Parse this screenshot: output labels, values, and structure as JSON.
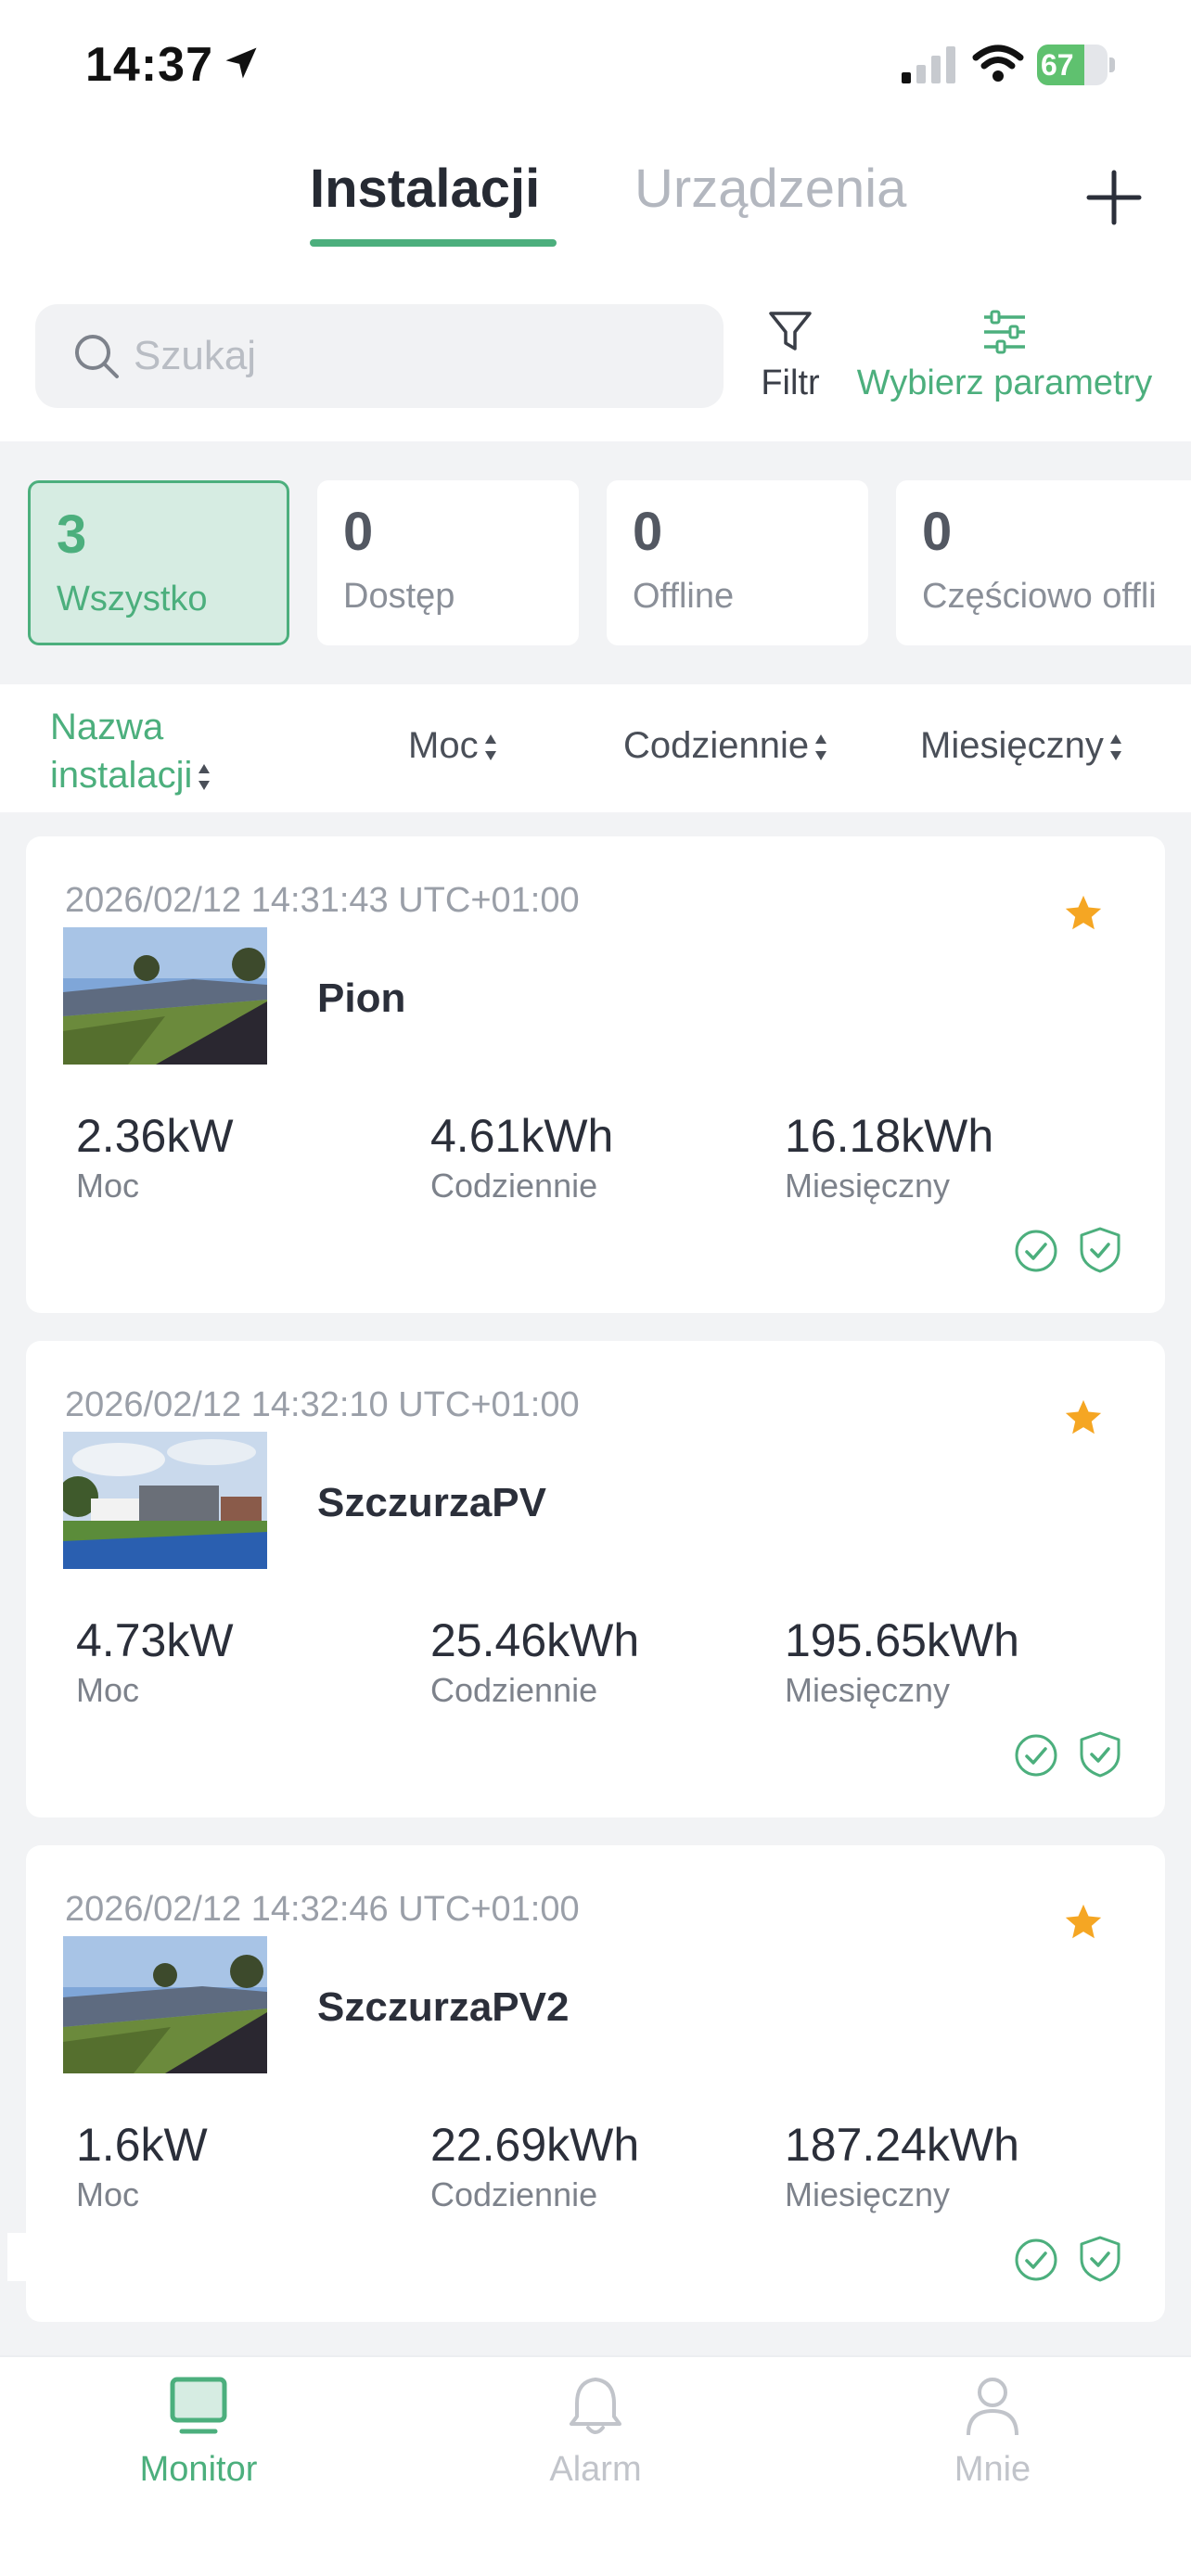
{
  "status_bar": {
    "time": "14:37",
    "battery_level": "67",
    "icons": [
      "location-arrow-icon",
      "cellular-signal-icon",
      "wifi-icon",
      "battery-charging-icon"
    ]
  },
  "header": {
    "tabs": [
      {
        "label": "Instalacji",
        "active": true
      },
      {
        "label": "Urządzenia",
        "active": false
      }
    ],
    "add_icon": "plus-icon"
  },
  "search": {
    "placeholder": "Szukaj",
    "value": "",
    "filter_label": "Filtr",
    "params_label": "Wybierz parametry"
  },
  "summary": [
    {
      "count": "3",
      "label": "Wszystko",
      "active": true
    },
    {
      "count": "0",
      "label": "Dostęp",
      "active": false
    },
    {
      "count": "0",
      "label": "Offline",
      "active": false
    },
    {
      "count": "0",
      "label": "Częściowo offli",
      "active": false
    }
  ],
  "columns": {
    "name_line1": "Nazwa",
    "name_line2": "instalacji",
    "power": "Moc",
    "daily": "Codziennie",
    "monthly": "Miesięczny"
  },
  "installations": [
    {
      "timestamp": "2026/02/12 14:31:43 UTC+01:00",
      "name": "Pion",
      "favorite": true,
      "power": "2.36kW",
      "power_label": "Moc",
      "daily": "4.61kWh",
      "daily_label": "Codziennie",
      "monthly": "16.18kWh",
      "monthly_label": "Miesięczny"
    },
    {
      "timestamp": "2026/02/12 14:32:10 UTC+01:00",
      "name": "SzczurzaPV",
      "favorite": true,
      "power": "4.73kW",
      "power_label": "Moc",
      "daily": "25.46kWh",
      "daily_label": "Codziennie",
      "monthly": "195.65kWh",
      "monthly_label": "Miesięczny"
    },
    {
      "timestamp": "2026/02/12 14:32:46 UTC+01:00",
      "name": "SzczurzaPV2",
      "favorite": true,
      "power": "1.6kW",
      "power_label": "Moc",
      "daily": "22.69kWh",
      "daily_label": "Codziennie",
      "monthly": "187.24kWh",
      "monthly_label": "Miesięczny"
    }
  ],
  "bottom_nav": [
    {
      "label": "Monitor",
      "icon": "monitor-icon",
      "active": true
    },
    {
      "label": "Alarm",
      "icon": "bell-icon",
      "active": false
    },
    {
      "label": "Mnie",
      "icon": "user-icon",
      "active": false
    }
  ],
  "colors": {
    "accent": "#4caf7d",
    "star": "#f5a623",
    "battery": "#5fc16f"
  }
}
